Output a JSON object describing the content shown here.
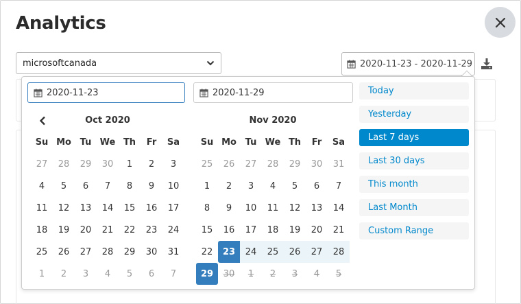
{
  "page": {
    "title": "Analytics"
  },
  "account_select": {
    "value": "microsoftcanada"
  },
  "date_range": {
    "value": "2020-11-23 - 2020-11-29"
  },
  "picker": {
    "start_date": "2020-11-23",
    "end_date": "2020-11-29",
    "weekdays": [
      "Su",
      "Mo",
      "Tu",
      "We",
      "Th",
      "Fr",
      "Sa"
    ],
    "left_month": {
      "title": "Oct 2020",
      "days": [
        {
          "d": "27",
          "s": "off"
        },
        {
          "d": "28",
          "s": "off"
        },
        {
          "d": "29",
          "s": "off"
        },
        {
          "d": "30",
          "s": "off"
        },
        {
          "d": "1",
          "s": ""
        },
        {
          "d": "2",
          "s": ""
        },
        {
          "d": "3",
          "s": ""
        },
        {
          "d": "4",
          "s": ""
        },
        {
          "d": "5",
          "s": ""
        },
        {
          "d": "6",
          "s": ""
        },
        {
          "d": "7",
          "s": ""
        },
        {
          "d": "8",
          "s": ""
        },
        {
          "d": "9",
          "s": ""
        },
        {
          "d": "10",
          "s": ""
        },
        {
          "d": "11",
          "s": ""
        },
        {
          "d": "12",
          "s": ""
        },
        {
          "d": "13",
          "s": ""
        },
        {
          "d": "14",
          "s": ""
        },
        {
          "d": "15",
          "s": ""
        },
        {
          "d": "16",
          "s": ""
        },
        {
          "d": "17",
          "s": ""
        },
        {
          "d": "18",
          "s": ""
        },
        {
          "d": "19",
          "s": ""
        },
        {
          "d": "20",
          "s": ""
        },
        {
          "d": "21",
          "s": ""
        },
        {
          "d": "22",
          "s": ""
        },
        {
          "d": "23",
          "s": ""
        },
        {
          "d": "24",
          "s": ""
        },
        {
          "d": "25",
          "s": ""
        },
        {
          "d": "26",
          "s": ""
        },
        {
          "d": "27",
          "s": ""
        },
        {
          "d": "28",
          "s": ""
        },
        {
          "d": "29",
          "s": ""
        },
        {
          "d": "30",
          "s": ""
        },
        {
          "d": "31",
          "s": ""
        },
        {
          "d": "1",
          "s": "off"
        },
        {
          "d": "2",
          "s": "off"
        },
        {
          "d": "3",
          "s": "off"
        },
        {
          "d": "4",
          "s": "off"
        },
        {
          "d": "5",
          "s": "off"
        },
        {
          "d": "6",
          "s": "off"
        },
        {
          "d": "7",
          "s": "off"
        }
      ]
    },
    "right_month": {
      "title": "Nov 2020",
      "days": [
        {
          "d": "25",
          "s": "off"
        },
        {
          "d": "26",
          "s": "off"
        },
        {
          "d": "27",
          "s": "off"
        },
        {
          "d": "28",
          "s": "off"
        },
        {
          "d": "29",
          "s": "off"
        },
        {
          "d": "30",
          "s": "off"
        },
        {
          "d": "31",
          "s": "off"
        },
        {
          "d": "1",
          "s": ""
        },
        {
          "d": "2",
          "s": ""
        },
        {
          "d": "3",
          "s": ""
        },
        {
          "d": "4",
          "s": ""
        },
        {
          "d": "5",
          "s": ""
        },
        {
          "d": "6",
          "s": ""
        },
        {
          "d": "7",
          "s": ""
        },
        {
          "d": "8",
          "s": ""
        },
        {
          "d": "9",
          "s": ""
        },
        {
          "d": "10",
          "s": ""
        },
        {
          "d": "11",
          "s": ""
        },
        {
          "d": "12",
          "s": ""
        },
        {
          "d": "13",
          "s": ""
        },
        {
          "d": "14",
          "s": ""
        },
        {
          "d": "15",
          "s": ""
        },
        {
          "d": "16",
          "s": ""
        },
        {
          "d": "17",
          "s": ""
        },
        {
          "d": "18",
          "s": ""
        },
        {
          "d": "19",
          "s": ""
        },
        {
          "d": "20",
          "s": ""
        },
        {
          "d": "21",
          "s": ""
        },
        {
          "d": "22",
          "s": ""
        },
        {
          "d": "23",
          "s": "sel start"
        },
        {
          "d": "24",
          "s": "in-range"
        },
        {
          "d": "25",
          "s": "in-range"
        },
        {
          "d": "26",
          "s": "in-range"
        },
        {
          "d": "27",
          "s": "in-range"
        },
        {
          "d": "28",
          "s": "in-range"
        },
        {
          "d": "29",
          "s": "sel"
        },
        {
          "d": "30",
          "s": "disabled"
        },
        {
          "d": "1",
          "s": "disabled"
        },
        {
          "d": "2",
          "s": "disabled"
        },
        {
          "d": "3",
          "s": "disabled"
        },
        {
          "d": "4",
          "s": "disabled"
        },
        {
          "d": "5",
          "s": "disabled"
        }
      ]
    },
    "ranges": [
      {
        "label": "Today",
        "active": false
      },
      {
        "label": "Yesterday",
        "active": false
      },
      {
        "label": "Last 7 days",
        "active": true
      },
      {
        "label": "Last 30 days",
        "active": false
      },
      {
        "label": "This month",
        "active": false
      },
      {
        "label": "Last Month",
        "active": false
      },
      {
        "label": "Custom Range",
        "active": false
      }
    ]
  },
  "colors": {
    "accent": "#0088cc",
    "selected_day": "#357ebd",
    "range_fill": "#ebf4f8",
    "close_bg": "#d8dbe0"
  },
  "icons": {
    "close": "close-icon",
    "calendar": "calendar-icon",
    "download": "download-icon",
    "prev": "chevron-left-icon",
    "dropdown": "chevron-down-icon"
  }
}
